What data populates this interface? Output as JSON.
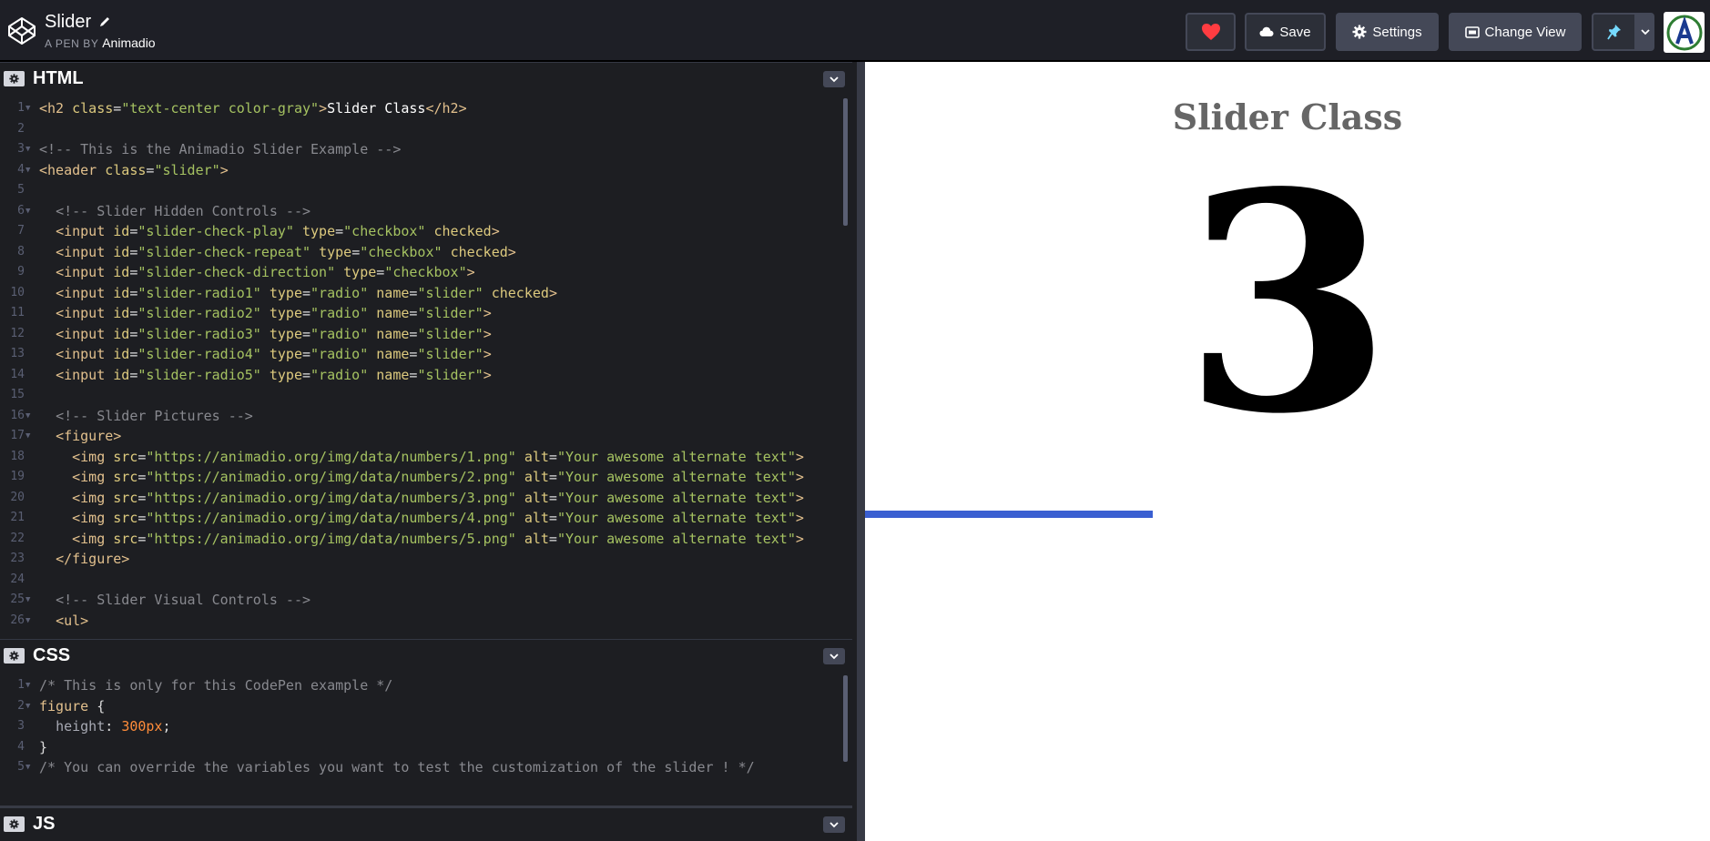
{
  "header": {
    "pen_title": "Slider",
    "byline_prefix": "A PEN BY",
    "author": "Animadio",
    "save_label": "Save",
    "settings_label": "Settings",
    "change_view_label": "Change View"
  },
  "colors": {
    "header_bg": "#1e1f26",
    "editor_bg": "#1d1e22",
    "button_bg": "#444857",
    "heart": "#ff3c41",
    "progress": "#3a5fd1",
    "pin": "#47cf73"
  },
  "icons": {
    "logo": "codepen-logo-icon",
    "pencil": "pencil-icon",
    "heart": "heart-icon",
    "cloud": "cloud-icon",
    "gear": "gear-icon",
    "view": "change-view-icon",
    "pin": "pin-icon",
    "chevron": "chevron-down-icon"
  },
  "panes": {
    "html_title": "HTML",
    "css_title": "CSS",
    "js_title": "JS"
  },
  "preview": {
    "title": "Slider Class",
    "number": "3",
    "progress_fraction": 0.34
  },
  "html_code": [
    {
      "n": "1",
      "fold": true,
      "tokens": [
        [
          "tag",
          "<h2 "
        ],
        [
          "attr",
          "class"
        ],
        [
          "punc",
          "="
        ],
        [
          "str",
          "\"text-center color-gray\""
        ],
        [
          "tag",
          ">"
        ],
        [
          "txt",
          "Slider Class"
        ],
        [
          "tag",
          "</h2>"
        ]
      ]
    },
    {
      "n": "2",
      "fold": false,
      "tokens": []
    },
    {
      "n": "3",
      "fold": true,
      "tokens": [
        [
          "com",
          "<!-- This is the Animadio Slider Example -->"
        ]
      ]
    },
    {
      "n": "4",
      "fold": true,
      "tokens": [
        [
          "tag",
          "<header "
        ],
        [
          "attr",
          "class"
        ],
        [
          "punc",
          "="
        ],
        [
          "str",
          "\"slider\""
        ],
        [
          "tag",
          ">"
        ]
      ]
    },
    {
      "n": "5",
      "fold": false,
      "tokens": []
    },
    {
      "n": "6",
      "fold": true,
      "tokens": [
        [
          "txt",
          "  "
        ],
        [
          "com",
          "<!-- Slider Hidden Controls -->"
        ]
      ]
    },
    {
      "n": "7",
      "fold": false,
      "tokens": [
        [
          "txt",
          "  "
        ],
        [
          "tag",
          "<input "
        ],
        [
          "attr",
          "id"
        ],
        [
          "punc",
          "="
        ],
        [
          "str",
          "\"slider-check-play\""
        ],
        [
          "txt",
          " "
        ],
        [
          "attr",
          "type"
        ],
        [
          "punc",
          "="
        ],
        [
          "str",
          "\"checkbox\""
        ],
        [
          "txt",
          " "
        ],
        [
          "attr",
          "checked"
        ],
        [
          "tag",
          ">"
        ]
      ]
    },
    {
      "n": "8",
      "fold": false,
      "tokens": [
        [
          "txt",
          "  "
        ],
        [
          "tag",
          "<input "
        ],
        [
          "attr",
          "id"
        ],
        [
          "punc",
          "="
        ],
        [
          "str",
          "\"slider-check-repeat\""
        ],
        [
          "txt",
          " "
        ],
        [
          "attr",
          "type"
        ],
        [
          "punc",
          "="
        ],
        [
          "str",
          "\"checkbox\""
        ],
        [
          "txt",
          " "
        ],
        [
          "attr",
          "checked"
        ],
        [
          "tag",
          ">"
        ]
      ]
    },
    {
      "n": "9",
      "fold": false,
      "tokens": [
        [
          "txt",
          "  "
        ],
        [
          "tag",
          "<input "
        ],
        [
          "attr",
          "id"
        ],
        [
          "punc",
          "="
        ],
        [
          "str",
          "\"slider-check-direction\""
        ],
        [
          "txt",
          " "
        ],
        [
          "attr",
          "type"
        ],
        [
          "punc",
          "="
        ],
        [
          "str",
          "\"checkbox\""
        ],
        [
          "tag",
          ">"
        ]
      ]
    },
    {
      "n": "10",
      "fold": false,
      "tokens": [
        [
          "txt",
          "  "
        ],
        [
          "tag",
          "<input "
        ],
        [
          "attr",
          "id"
        ],
        [
          "punc",
          "="
        ],
        [
          "str",
          "\"slider-radio1\""
        ],
        [
          "txt",
          " "
        ],
        [
          "attr",
          "type"
        ],
        [
          "punc",
          "="
        ],
        [
          "str",
          "\"radio\""
        ],
        [
          "txt",
          " "
        ],
        [
          "attr",
          "name"
        ],
        [
          "punc",
          "="
        ],
        [
          "str",
          "\"slider\""
        ],
        [
          "txt",
          " "
        ],
        [
          "attr",
          "checked"
        ],
        [
          "tag",
          ">"
        ]
      ]
    },
    {
      "n": "11",
      "fold": false,
      "tokens": [
        [
          "txt",
          "  "
        ],
        [
          "tag",
          "<input "
        ],
        [
          "attr",
          "id"
        ],
        [
          "punc",
          "="
        ],
        [
          "str",
          "\"slider-radio2\""
        ],
        [
          "txt",
          " "
        ],
        [
          "attr",
          "type"
        ],
        [
          "punc",
          "="
        ],
        [
          "str",
          "\"radio\""
        ],
        [
          "txt",
          " "
        ],
        [
          "attr",
          "name"
        ],
        [
          "punc",
          "="
        ],
        [
          "str",
          "\"slider\""
        ],
        [
          "tag",
          ">"
        ]
      ]
    },
    {
      "n": "12",
      "fold": false,
      "tokens": [
        [
          "txt",
          "  "
        ],
        [
          "tag",
          "<input "
        ],
        [
          "attr",
          "id"
        ],
        [
          "punc",
          "="
        ],
        [
          "str",
          "\"slider-radio3\""
        ],
        [
          "txt",
          " "
        ],
        [
          "attr",
          "type"
        ],
        [
          "punc",
          "="
        ],
        [
          "str",
          "\"radio\""
        ],
        [
          "txt",
          " "
        ],
        [
          "attr",
          "name"
        ],
        [
          "punc",
          "="
        ],
        [
          "str",
          "\"slider\""
        ],
        [
          "tag",
          ">"
        ]
      ]
    },
    {
      "n": "13",
      "fold": false,
      "tokens": [
        [
          "txt",
          "  "
        ],
        [
          "tag",
          "<input "
        ],
        [
          "attr",
          "id"
        ],
        [
          "punc",
          "="
        ],
        [
          "str",
          "\"slider-radio4\""
        ],
        [
          "txt",
          " "
        ],
        [
          "attr",
          "type"
        ],
        [
          "punc",
          "="
        ],
        [
          "str",
          "\"radio\""
        ],
        [
          "txt",
          " "
        ],
        [
          "attr",
          "name"
        ],
        [
          "punc",
          "="
        ],
        [
          "str",
          "\"slider\""
        ],
        [
          "tag",
          ">"
        ]
      ]
    },
    {
      "n": "14",
      "fold": false,
      "tokens": [
        [
          "txt",
          "  "
        ],
        [
          "tag",
          "<input "
        ],
        [
          "attr",
          "id"
        ],
        [
          "punc",
          "="
        ],
        [
          "str",
          "\"slider-radio5\""
        ],
        [
          "txt",
          " "
        ],
        [
          "attr",
          "type"
        ],
        [
          "punc",
          "="
        ],
        [
          "str",
          "\"radio\""
        ],
        [
          "txt",
          " "
        ],
        [
          "attr",
          "name"
        ],
        [
          "punc",
          "="
        ],
        [
          "str",
          "\"slider\""
        ],
        [
          "tag",
          ">"
        ]
      ]
    },
    {
      "n": "15",
      "fold": false,
      "tokens": []
    },
    {
      "n": "16",
      "fold": true,
      "tokens": [
        [
          "txt",
          "  "
        ],
        [
          "com",
          "<!-- Slider Pictures -->"
        ]
      ]
    },
    {
      "n": "17",
      "fold": true,
      "tokens": [
        [
          "txt",
          "  "
        ],
        [
          "tag",
          "<figure>"
        ]
      ]
    },
    {
      "n": "18",
      "fold": false,
      "tokens": [
        [
          "txt",
          "    "
        ],
        [
          "tag",
          "<img "
        ],
        [
          "attr",
          "src"
        ],
        [
          "punc",
          "="
        ],
        [
          "str",
          "\"https://animadio.org/img/data/numbers/1.png\""
        ],
        [
          "txt",
          " "
        ],
        [
          "attr",
          "alt"
        ],
        [
          "punc",
          "="
        ],
        [
          "str",
          "\"Your awesome alternate text\""
        ],
        [
          "tag",
          ">"
        ]
      ]
    },
    {
      "n": "19",
      "fold": false,
      "tokens": [
        [
          "txt",
          "    "
        ],
        [
          "tag",
          "<img "
        ],
        [
          "attr",
          "src"
        ],
        [
          "punc",
          "="
        ],
        [
          "str",
          "\"https://animadio.org/img/data/numbers/2.png\""
        ],
        [
          "txt",
          " "
        ],
        [
          "attr",
          "alt"
        ],
        [
          "punc",
          "="
        ],
        [
          "str",
          "\"Your awesome alternate text\""
        ],
        [
          "tag",
          ">"
        ]
      ]
    },
    {
      "n": "20",
      "fold": false,
      "tokens": [
        [
          "txt",
          "    "
        ],
        [
          "tag",
          "<img "
        ],
        [
          "attr",
          "src"
        ],
        [
          "punc",
          "="
        ],
        [
          "str",
          "\"https://animadio.org/img/data/numbers/3.png\""
        ],
        [
          "txt",
          " "
        ],
        [
          "attr",
          "alt"
        ],
        [
          "punc",
          "="
        ],
        [
          "str",
          "\"Your awesome alternate text\""
        ],
        [
          "tag",
          ">"
        ]
      ]
    },
    {
      "n": "21",
      "fold": false,
      "tokens": [
        [
          "txt",
          "    "
        ],
        [
          "tag",
          "<img "
        ],
        [
          "attr",
          "src"
        ],
        [
          "punc",
          "="
        ],
        [
          "str",
          "\"https://animadio.org/img/data/numbers/4.png\""
        ],
        [
          "txt",
          " "
        ],
        [
          "attr",
          "alt"
        ],
        [
          "punc",
          "="
        ],
        [
          "str",
          "\"Your awesome alternate text\""
        ],
        [
          "tag",
          ">"
        ]
      ]
    },
    {
      "n": "22",
      "fold": false,
      "tokens": [
        [
          "txt",
          "    "
        ],
        [
          "tag",
          "<img "
        ],
        [
          "attr",
          "src"
        ],
        [
          "punc",
          "="
        ],
        [
          "str",
          "\"https://animadio.org/img/data/numbers/5.png\""
        ],
        [
          "txt",
          " "
        ],
        [
          "attr",
          "alt"
        ],
        [
          "punc",
          "="
        ],
        [
          "str",
          "\"Your awesome alternate text\""
        ],
        [
          "tag",
          ">"
        ]
      ]
    },
    {
      "n": "23",
      "fold": false,
      "tokens": [
        [
          "txt",
          "  "
        ],
        [
          "tag",
          "</figure>"
        ]
      ]
    },
    {
      "n": "24",
      "fold": false,
      "tokens": []
    },
    {
      "n": "25",
      "fold": true,
      "tokens": [
        [
          "txt",
          "  "
        ],
        [
          "com",
          "<!-- Slider Visual Controls -->"
        ]
      ]
    },
    {
      "n": "26",
      "fold": true,
      "tokens": [
        [
          "txt",
          "  "
        ],
        [
          "tag",
          "<ul>"
        ]
      ]
    }
  ],
  "css_code": [
    {
      "n": "1",
      "fold": true,
      "tokens": [
        [
          "com",
          "/* This is only for this CodePen example */"
        ]
      ]
    },
    {
      "n": "2",
      "fold": true,
      "tokens": [
        [
          "tag",
          "figure "
        ],
        [
          "punc",
          "{"
        ]
      ]
    },
    {
      "n": "3",
      "fold": false,
      "tokens": [
        [
          "txt",
          "  "
        ],
        [
          "prop",
          "height"
        ],
        [
          "punc",
          ": "
        ],
        [
          "num",
          "300px"
        ],
        [
          "punc",
          ";"
        ]
      ]
    },
    {
      "n": "4",
      "fold": false,
      "tokens": [
        [
          "punc",
          "}"
        ]
      ]
    },
    {
      "n": "5",
      "fold": true,
      "tokens": [
        [
          "com",
          "/* You can override the variables you want to test the customization of the slider ! */"
        ]
      ]
    }
  ]
}
